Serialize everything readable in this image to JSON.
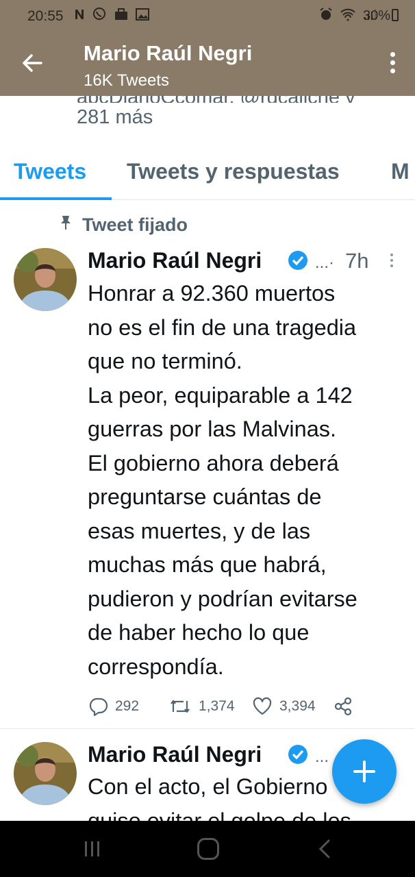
{
  "status_bar": {
    "time": "20:55",
    "left_icons": [
      "notification-n-icon",
      "whatsapp-icon",
      "briefcase-icon",
      "gallery-icon"
    ],
    "right_icons": [
      "alarm-icon",
      "wifi-icon",
      "signal-icon"
    ],
    "battery": "30%"
  },
  "header": {
    "title": "Mario Raúl Negri",
    "subtitle": "16K Tweets",
    "background": "#8a7b68"
  },
  "profile": {
    "followed_by_cut": "abcDiarioCcomar, @rdcaliche y",
    "followed_by_more": "281 más"
  },
  "tabs": [
    {
      "label": "Tweets",
      "active": true
    },
    {
      "label": "Tweets y respuestas",
      "active": false
    },
    {
      "label": "M",
      "active": false
    }
  ],
  "pinned_label": "Tweet fijado",
  "tweets": [
    {
      "name": "Mario Raúl Negri",
      "handle_ellipsis": "...·",
      "time": "7h",
      "text": "Honrar a 92.360 muertos\nno es el fin de una tragedia\nque no terminó.\nLa peor, equiparable a 142\nguerras por las Malvinas.\nEl gobierno ahora deberá\npreguntarse cuántas de\nesas muertes, y de las\nmuchas más que habrá,\npudieron y podrían evitarse\nde haber hecho lo que\ncorrespondía.",
      "replies": "292",
      "retweets": "1,374",
      "likes": "3,394"
    },
    {
      "name": "Mario Raúl Negri",
      "handle_ellipsis": "...",
      "text": "Con el acto, el Gobierno\nquiso evitar el golpe de los"
    }
  ],
  "colors": {
    "accent": "#1d9bf0",
    "secondary_text": "#536471"
  }
}
